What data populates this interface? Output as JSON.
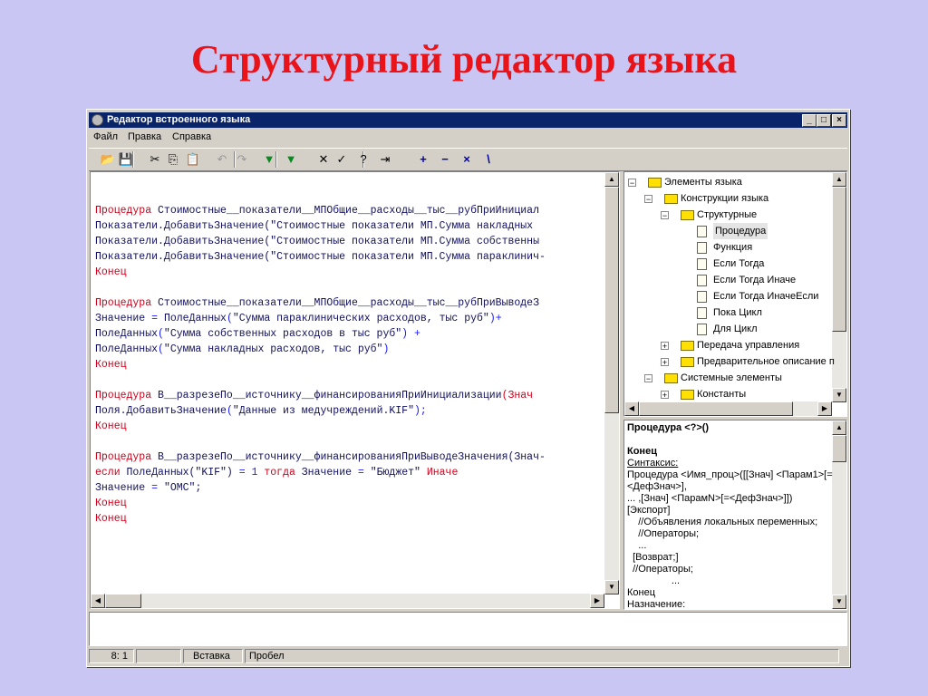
{
  "slide": {
    "title": "Структурный редактор языка"
  },
  "window": {
    "title": "Редактор встроенного языка",
    "min": "_",
    "max": "□",
    "close": "×"
  },
  "menu": [
    "Файл",
    "Правка",
    "Справка"
  ],
  "toolbar": {
    "buttons": [
      {
        "name": "open-folder-icon",
        "glyph": "📂"
      },
      {
        "name": "save-icon",
        "glyph": "💾"
      },
      {
        "name": "cut-icon",
        "glyph": "✂"
      },
      {
        "name": "copy-icon",
        "glyph": "⎘"
      },
      {
        "name": "paste-icon",
        "glyph": "📋"
      },
      {
        "name": "undo-icon",
        "glyph": "↶"
      },
      {
        "name": "redo-icon",
        "glyph": "↷"
      },
      {
        "name": "insert-green-icon",
        "glyph": "▼"
      },
      {
        "name": "insert-green-dropdown-icon",
        "glyph": "▼"
      },
      {
        "name": "delete-x-icon",
        "glyph": "✕"
      },
      {
        "name": "check-icon",
        "glyph": "✓"
      },
      {
        "name": "help-cursor-icon",
        "glyph": "?"
      },
      {
        "name": "exit-door-icon",
        "glyph": "⇥"
      },
      {
        "name": "plus-icon",
        "glyph": "+"
      },
      {
        "name": "minus-icon",
        "glyph": "−"
      },
      {
        "name": "multiply-icon",
        "glyph": "×"
      },
      {
        "name": "divide-icon",
        "glyph": "\\"
      }
    ]
  },
  "code_lines": [
    {
      "parts": [
        {
          "t": "Процедура ",
          "c": "kw"
        },
        {
          "t": "Стоимостные__показатели__МПОбщие__расходы__тыс__рубПриИнициал",
          "c": "tx"
        }
      ]
    },
    {
      "parts": [
        {
          "t": "Показатели.ДобавитьЗначение(\"Стоимостные показатели МП.Сумма накладных",
          "c": "tx"
        }
      ]
    },
    {
      "parts": [
        {
          "t": "Показатели.ДобавитьЗначение(\"Стоимостные показатели МП.Сумма собственны",
          "c": "tx"
        }
      ]
    },
    {
      "parts": [
        {
          "t": "Показатели.ДобавитьЗначение(\"Стоимостные показатели МП.Сумма параклинич-",
          "c": "tx"
        }
      ]
    },
    {
      "parts": [
        {
          "t": "Конец",
          "c": "kw"
        }
      ]
    },
    {
      "parts": [
        {
          "t": "",
          "c": "tx"
        }
      ]
    },
    {
      "parts": [
        {
          "t": "Процедура ",
          "c": "kw"
        },
        {
          "t": "Стоимостные__показатели__МПОбщие__расходы__тыс__рубПриВыводеЗ",
          "c": "tx"
        }
      ]
    },
    {
      "parts": [
        {
          "t": "Значение ",
          "c": "tx"
        },
        {
          "t": "= ",
          "c": "op"
        },
        {
          "t": "ПолеДанных",
          "c": "tx"
        },
        {
          "t": "(",
          "c": "op"
        },
        {
          "t": "\"Сумма параклинических расходов, тыс руб\"",
          "c": "tx"
        },
        {
          "t": ")+",
          "c": "op"
        }
      ]
    },
    {
      "parts": [
        {
          "t": "ПолеДанных",
          "c": "tx"
        },
        {
          "t": "(",
          "c": "op"
        },
        {
          "t": "\"Сумма собственных расходов в тыс руб\"",
          "c": "tx"
        },
        {
          "t": ") +",
          "c": "op"
        }
      ]
    },
    {
      "parts": [
        {
          "t": "ПолеДанных",
          "c": "tx"
        },
        {
          "t": "(",
          "c": "op"
        },
        {
          "t": "\"Сумма накладных расходов, тыс руб\"",
          "c": "tx"
        },
        {
          "t": ")",
          "c": "op"
        }
      ]
    },
    {
      "parts": [
        {
          "t": "Конец",
          "c": "kw"
        }
      ]
    },
    {
      "parts": [
        {
          "t": "",
          "c": "tx"
        }
      ]
    },
    {
      "parts": [
        {
          "t": "Процедура ",
          "c": "kw"
        },
        {
          "t": "В__разрезеПо__источнику__финансированияПриИнициализации",
          "c": "tx"
        },
        {
          "t": "(Знач",
          "c": "kw"
        }
      ]
    },
    {
      "parts": [
        {
          "t": "Поля.ДобавитьЗначение",
          "c": "tx"
        },
        {
          "t": "(",
          "c": "op"
        },
        {
          "t": "\"Данные из медучреждений.KIF\"",
          "c": "tx"
        },
        {
          "t": ");",
          "c": "op"
        }
      ]
    },
    {
      "parts": [
        {
          "t": "Конец",
          "c": "kw"
        }
      ]
    },
    {
      "parts": [
        {
          "t": "",
          "c": "tx"
        }
      ]
    },
    {
      "parts": [
        {
          "t": "Процедура ",
          "c": "kw"
        },
        {
          "t": "В__разрезеПо__источнику__финансированияПриВыводеЗначения(Знач-",
          "c": "tx"
        }
      ]
    },
    {
      "parts": [
        {
          "t": "если ",
          "c": "kw"
        },
        {
          "t": "ПолеДанных(\"KIF\") ",
          "c": "tx"
        },
        {
          "t": "= 1 ",
          "c": "op"
        },
        {
          "t": "тогда ",
          "c": "kw"
        },
        {
          "t": "Значение ",
          "c": "tx"
        },
        {
          "t": "= ",
          "c": "op"
        },
        {
          "t": "\"Бюджет\" ",
          "c": "tx"
        },
        {
          "t": "Иначе",
          "c": "kw"
        }
      ]
    },
    {
      "parts": [
        {
          "t": "Значение ",
          "c": "tx"
        },
        {
          "t": "= ",
          "c": "op"
        },
        {
          "t": "\"ОМС\";",
          "c": "tx"
        }
      ]
    },
    {
      "parts": [
        {
          "t": "Конец",
          "c": "kw"
        }
      ]
    },
    {
      "parts": [
        {
          "t": "Конец",
          "c": "kw"
        }
      ]
    }
  ],
  "tree": [
    {
      "label": "Элементы языка",
      "level": 0,
      "icon": "folder",
      "exp": "−"
    },
    {
      "label": "Конструкции языка",
      "level": 1,
      "icon": "folder",
      "exp": "−"
    },
    {
      "label": "Структурные",
      "level": 2,
      "icon": "folder",
      "exp": "−"
    },
    {
      "label": "Процедура",
      "level": 3,
      "icon": "doc",
      "exp": "",
      "selected": true
    },
    {
      "label": "Функция",
      "level": 3,
      "icon": "doc",
      "exp": ""
    },
    {
      "label": "Если Тогда",
      "level": 3,
      "icon": "doc",
      "exp": ""
    },
    {
      "label": "Если Тогда Иначе",
      "level": 3,
      "icon": "doc",
      "exp": ""
    },
    {
      "label": "Если Тогда ИначеЕсли",
      "level": 3,
      "icon": "doc",
      "exp": ""
    },
    {
      "label": "Пока Цикл",
      "level": 3,
      "icon": "doc",
      "exp": ""
    },
    {
      "label": "Для Цикл",
      "level": 3,
      "icon": "doc",
      "exp": ""
    },
    {
      "label": "Передача управления",
      "level": 2,
      "icon": "folder",
      "exp": "+"
    },
    {
      "label": "Предварительное описание п",
      "level": 2,
      "icon": "folder",
      "exp": "+"
    },
    {
      "label": "Системные элементы",
      "level": 1,
      "icon": "folder",
      "exp": "−"
    },
    {
      "label": "Константы",
      "level": 2,
      "icon": "folder",
      "exp": "+"
    }
  ],
  "help_lines": [
    {
      "t": "Процедура <?>()",
      "b": true,
      "u": false
    },
    {
      "t": "",
      "b": false,
      "u": false
    },
    {
      "t": "Конец",
      "b": true,
      "u": false
    },
    {
      "t": "Синтаксис:",
      "b": false,
      "u": true
    },
    {
      "t": "Процедура <Имя_проц>([[Знач] <Парам1>[=",
      "b": false,
      "u": false
    },
    {
      "t": "<ДефЗнач>],",
      "b": false,
      "u": false
    },
    {
      "t": "... ,[Знач] <ПарамN>[=<ДефЗнач>]])",
      "b": false,
      "u": false
    },
    {
      "t": "[Экспорт]",
      "b": false,
      "u": false
    },
    {
      "t": "    //Объявления локальных переменных;",
      "b": false,
      "u": false
    },
    {
      "t": "    //Операторы;",
      "b": false,
      "u": false
    },
    {
      "t": "    ...",
      "b": false,
      "u": false
    },
    {
      "t": "  [Возврат;]",
      "b": false,
      "u": false
    },
    {
      "t": "  //Операторы;",
      "b": false,
      "u": false
    },
    {
      "t": "                ...",
      "b": false,
      "u": false
    },
    {
      "t": "Конец",
      "b": false,
      "u": false
    },
    {
      "t": "Назначение:",
      "b": false,
      "u": false
    }
  ],
  "status": {
    "position": "8: 1",
    "empty": "",
    "mode": "Вставка",
    "char": "Пробел"
  }
}
